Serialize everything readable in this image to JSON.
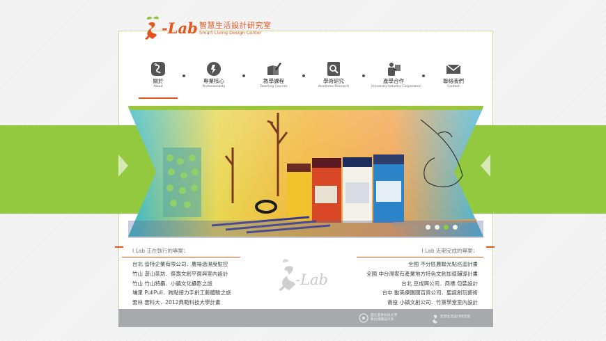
{
  "header": {
    "logo_text": "-Lab",
    "logo_title_zh": "智慧生活設計研究室",
    "logo_title_en": "Smart Living Design Center"
  },
  "nav": [
    {
      "label_zh": "關於",
      "label_en": "About",
      "icon": "about-icon"
    },
    {
      "label_zh": "專業核心",
      "label_en": "Professionality",
      "icon": "core-icon"
    },
    {
      "label_zh": "教學課程",
      "label_en": "Teaching Courses",
      "icon": "pencil-book-icon"
    },
    {
      "label_zh": "學術研究",
      "label_en": "Academic Research",
      "icon": "magnifier-icon"
    },
    {
      "label_zh": "產學合作",
      "label_en": "University-Industry Cooperation",
      "icon": "handshake-icon"
    },
    {
      "label_zh": "聯絡我們",
      "label_en": "Contact",
      "icon": "envelope-icon"
    }
  ],
  "slider": {
    "dot_count": 4,
    "active_index": 2
  },
  "projects_current": {
    "title": "I Lab 正在執行的專案：",
    "items": [
      "台北 音特企業有限公司．農場溫濕度監控",
      "竹山 遊山茶坊．祭壽文創平面與室內設計",
      "竹山 竹山特攝．小鎮文化攝影之旅",
      "埔里 PuliPuli．跨點接力手創工藝體驗之旅",
      "雲林 雲科大．2012典範科技大學計畫"
    ]
  },
  "projects_done": {
    "title": "I Lab 近期完成的專案：",
    "items": [
      "全國 不分區農聯光點巡迴計畫",
      "全國 中台灣家有產業地方特色文創加值輔導計畫",
      "台北 豆成興公司．商標.包裝設計",
      "台中 動美療園國百貨公司．聖誕創玩藝術",
      "南投 小鎮文創公司．竹黨學堂室內設計"
    ]
  },
  "center_logo_text": "-Lab",
  "footer": {
    "partner1_line1": "國立雲林科技大學",
    "partner1_line2": "數位媒體設計系",
    "partner2_line1": "智慧生活設計研究室"
  },
  "colors": {
    "accent": "#e4541d",
    "green": "#93c93e",
    "footer": "#a7a9ac"
  }
}
